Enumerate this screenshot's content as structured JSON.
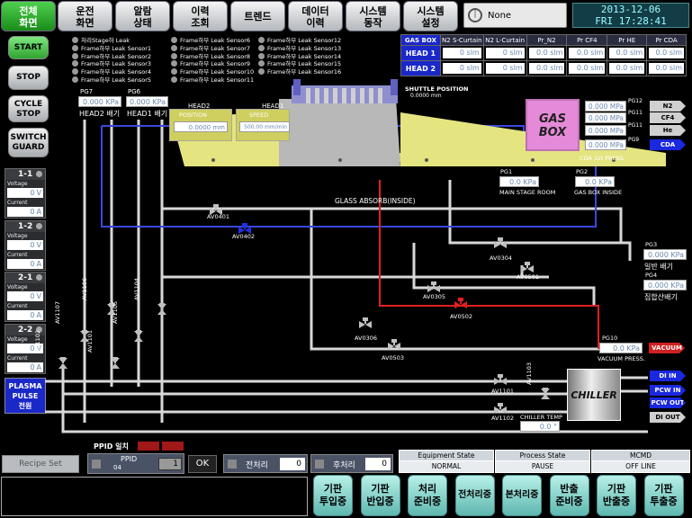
{
  "tabs": [
    {
      "label": "전체\n화면",
      "active": true
    },
    {
      "label": "운전\n화면"
    },
    {
      "label": "알람\n상태"
    },
    {
      "label": "이력\n조회"
    },
    {
      "label": "트렌드"
    },
    {
      "label": "데이터\n이력"
    },
    {
      "label": "시스템\n동작"
    },
    {
      "label": "시스템\n설정"
    }
  ],
  "recipe_select": "None",
  "datetime": {
    "date": "2013-12-06",
    "day": "FRI",
    "time": "17:28:41"
  },
  "left_buttons": {
    "start": "START",
    "stop": "STOP",
    "cycle_stop": "CYCLE\nSTOP",
    "switch_guard": "SWITCH\nGUARD"
  },
  "leak_legend": {
    "col1": [
      "처리Stage하 Leak",
      "Frame하부 Leak Sensor1",
      "Frame하부 Leak Sensor2",
      "Frame하부 Leak Sensor3",
      "Frame하부 Leak Sensor4",
      "Frame하부 Leak Sensor5"
    ],
    "col2": [
      "Frame하부 Leak Sensor6",
      "Frame하부 Leak Sensor7",
      "Frame하부 Leak Sensor8",
      "Frame하부 Leak Sensor9",
      "Frame하부 Leak Sensor10",
      "Frame하부 Leak Sensor11"
    ],
    "col3": [
      "Frame하부 Leak Sensor12",
      "Frame하부 Leak Sensor13",
      "Frame하부 Leak Sensor14",
      "Frame하부 Leak Sensor15",
      "Frame하부 Leak Sensor16"
    ]
  },
  "plasma": [
    {
      "name": "1-1",
      "voltage_label": "Voltage",
      "voltage": "0",
      "v_unit": "V",
      "current_label": "Current",
      "current": "0",
      "c_unit": "A"
    },
    {
      "name": "1-2",
      "voltage_label": "Voltage",
      "voltage": "0",
      "v_unit": "V",
      "current_label": "Current",
      "current": "0",
      "c_unit": "A"
    },
    {
      "name": "2-1",
      "voltage_label": "Voltage",
      "voltage": "0",
      "v_unit": "V",
      "current_label": "Current",
      "current": "0",
      "c_unit": "A"
    },
    {
      "name": "2-2",
      "voltage_label": "Voltage",
      "voltage": "0",
      "v_unit": "V",
      "current_label": "Current",
      "current": "0",
      "c_unit": "A"
    }
  ],
  "plasma_pulse": "PLASMA\nPULSE\n전원",
  "gas_table": {
    "headers": [
      "GAS BOX",
      "N2 S-Curtain",
      "N2 L-Curtain",
      "Pr_N2",
      "Pr CF4",
      "Pr HE",
      "Pr CDA"
    ],
    "rows": [
      {
        "name": "HEAD 1",
        "values": [
          "0 slm",
          "0 slm",
          "0.0 slm",
          "0.0 slm",
          "0.0 slm",
          "0.0 slm"
        ]
      },
      {
        "name": "HEAD 2",
        "values": [
          "0 slm",
          "0 slm",
          "0.0 slm",
          "0.0 slm",
          "0.0 slm",
          "0.0 slm"
        ]
      }
    ]
  },
  "pg7": {
    "tag": "PG7",
    "value": "0.000 KPa",
    "label": "HEAD2 배기"
  },
  "pg6": {
    "tag": "PG6",
    "value": "0.000 KPa",
    "label": "HEAD1 배기"
  },
  "head2": {
    "title": "HEAD2",
    "label": "POSITION",
    "value": "0.0000 mm"
  },
  "head1": {
    "title": "HEAD1",
    "label": "SPEED",
    "value": "500.00 mm/min"
  },
  "shuttle": {
    "label": "SHUTTLE POSITION",
    "value": "0.0000 mm"
  },
  "gas_box_label": "GAS\nBOX",
  "gas_outputs": [
    {
      "tag": "PG12",
      "value": "0.000 MPa",
      "gas": "N2"
    },
    {
      "tag": "PG11",
      "value": "0.000 MPa",
      "gas": "CF4"
    },
    {
      "tag": "PG11",
      "value": "0.000 MPa",
      "gas": "He"
    },
    {
      "tag": "PG9",
      "value": "0.000 MPa",
      "gas": "CDA"
    }
  ],
  "cda_label": "CDA 1st PRESS.",
  "pg1": {
    "tag": "PG1",
    "value": "0.0 KPa",
    "label": "MAIN STAGE ROOM"
  },
  "pg2": {
    "tag": "PG2",
    "value": "0.0 KPa",
    "label": "GAS BOX INSIDE"
  },
  "pg3": {
    "tag": "PG3",
    "value": "0.000 KPa",
    "label": "일반 배기"
  },
  "pg4": {
    "tag": "PG4",
    "value": "0.000 KPa",
    "label": "집합산배기"
  },
  "pg10": {
    "tag": "PG10",
    "value": "0.0 KPa",
    "label": "VACUUM PRESS."
  },
  "glass_absorb": "GLASS ABSORB(INSIDE)",
  "valves": [
    "AV0401",
    "AV0402",
    "AV0304",
    "AV0501",
    "AV0305",
    "AV0502",
    "AV0306",
    "AV0503",
    "AV1107",
    "AV1106",
    "AV1105",
    "AV1104",
    "AV1102",
    "AV1101",
    "AV1101",
    "AV1103",
    "AV1102"
  ],
  "vacuum": "VACUUM",
  "chiller": "CHILLER",
  "chiller_temp": {
    "label": "CHILLER TEMP",
    "value": "0.0 °"
  },
  "chiller_ports": [
    "DI IN",
    "PCW IN",
    "PCW OUT",
    "DI OUT"
  ],
  "recipe_set": "Recipe Set",
  "ppid": {
    "match_label": "PPID 일치",
    "label": "PPID",
    "sub": "04",
    "value": "1",
    "ok": "OK"
  },
  "pre_process": {
    "label": "전처리",
    "value": "0"
  },
  "post_process": {
    "label": "후처리",
    "value": "0"
  },
  "states": [
    {
      "title": "Equipment State",
      "value": "NORMAL"
    },
    {
      "title": "Process State",
      "value": "PAUSE"
    },
    {
      "title": "MCMD",
      "value": "OFF LINE"
    }
  ],
  "bottom_buttons": [
    "기판\n투입중",
    "기판\n반입중",
    "처리\n준비중",
    "전처리중",
    "본처리중",
    "반출\n준비중",
    "기판\n반출중",
    "기판\n투출중"
  ],
  "colors": {
    "active_tab": "#2aa02a",
    "gas_box": "#e080d0",
    "head": "#e0e080",
    "vacuum": "#e02020",
    "cda": "#2040e0"
  }
}
